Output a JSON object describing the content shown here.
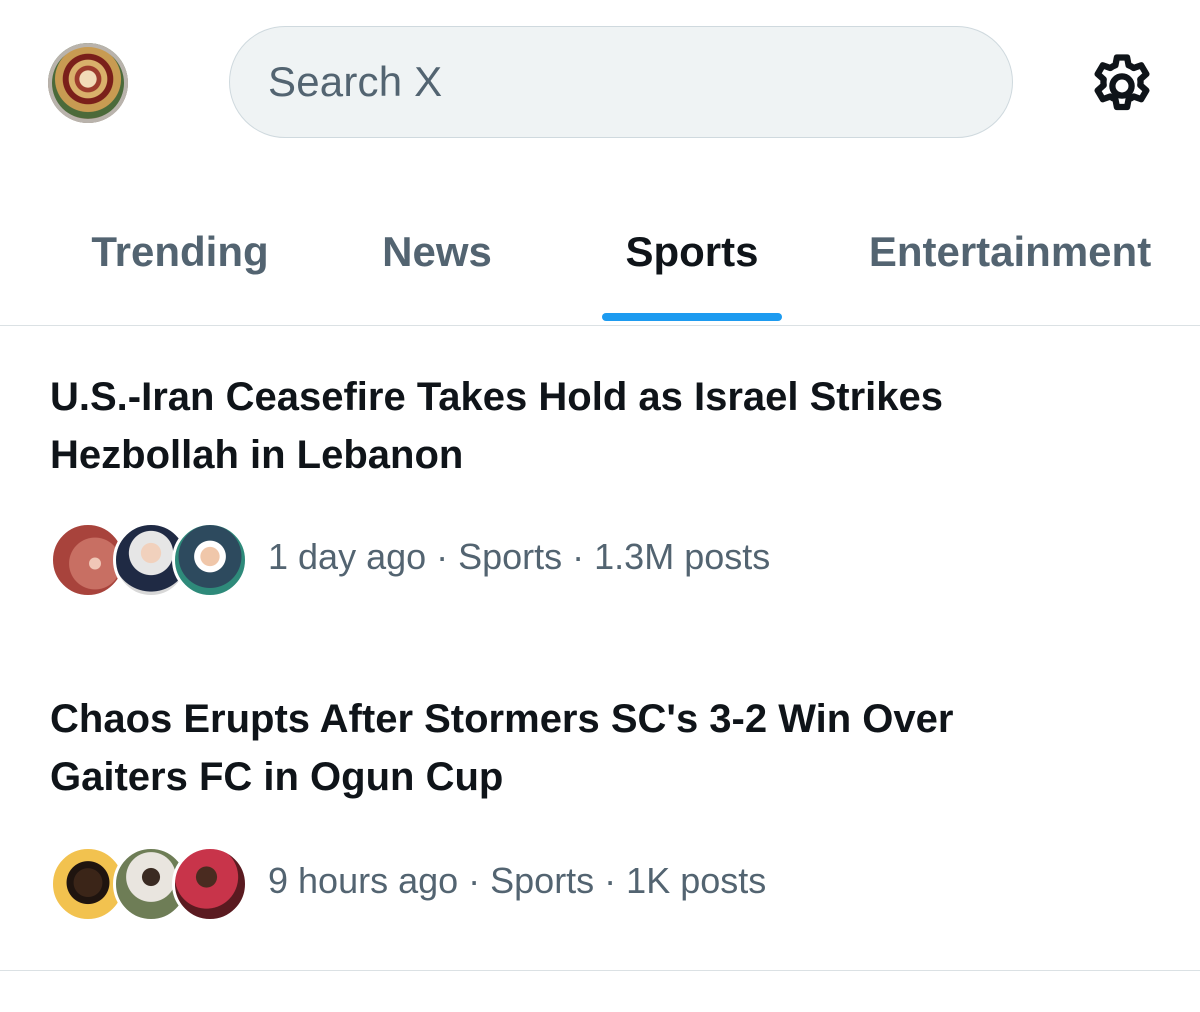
{
  "header": {
    "search_placeholder": "Search X",
    "profile_avatar_icon": "profile-avatar-icon",
    "settings_icon": "gear-icon"
  },
  "tabs": [
    {
      "label": "Trending",
      "active": false
    },
    {
      "label": "News",
      "active": false
    },
    {
      "label": "Sports",
      "active": true
    },
    {
      "label": "Entertainment",
      "active": false
    }
  ],
  "trends": [
    {
      "title": "U.S.-Iran Ceasefire Takes Hold as Israel Strikes Hezbollah in Lebanon",
      "meta": "1 day ago · Sports · 1.3M posts"
    },
    {
      "title": "Chaos Erupts After Stormers SC's 3-2 Win Over Gaiters FC in Ogun Cup",
      "meta": "9 hours ago · Sports · 1K posts"
    }
  ],
  "colors": {
    "accent": "#1d9bf0",
    "muted_text": "#536471",
    "primary_text": "#0f1419",
    "search_bg": "#eff3f4"
  }
}
